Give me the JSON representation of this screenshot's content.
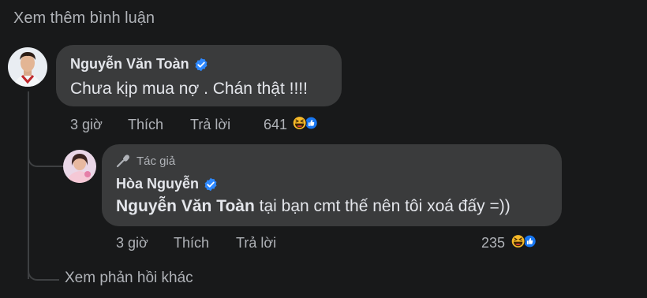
{
  "more_comments_label": "Xem thêm bình luận",
  "comment1": {
    "author": "Nguyễn Văn Toàn",
    "text": "Chưa kịp mua nợ . Chán thật !!!!",
    "time": "3 giờ",
    "like_label": "Thích",
    "reply_label": "Trả lời",
    "reaction_count": "641"
  },
  "reply1": {
    "author_tag": "Tác giả",
    "author": "Hòa Nguyễn",
    "mention": "Nguyễn Văn Toàn",
    "text": " tại bạn cmt thế nên tôi xoá đấy =))",
    "time": "3 giờ",
    "like_label": "Thích",
    "reply_label": "Trả lời",
    "reaction_count": "235"
  },
  "more_replies_label": "Xem phản hồi khác",
  "colors": {
    "background": "#18191a",
    "bubble": "#3a3b3c",
    "verified": "#2d88ff",
    "like_blue": "#1877f2",
    "haha_yellow": "#f7b928"
  }
}
